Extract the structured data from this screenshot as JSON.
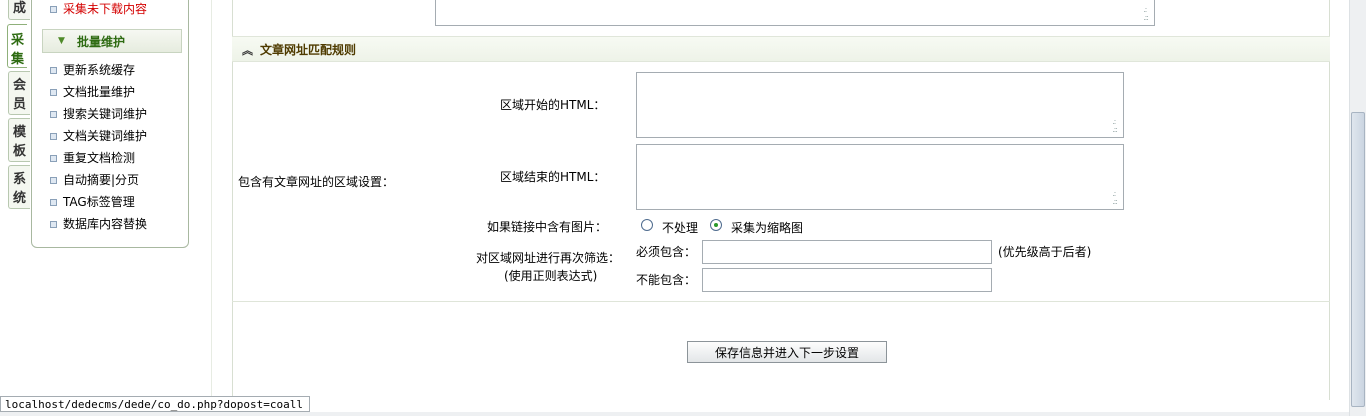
{
  "side_tabs": [
    {
      "label": "成",
      "active": false
    },
    {
      "label": "采集",
      "active": true
    },
    {
      "label": "会员",
      "active": false
    },
    {
      "label": "模板",
      "active": false
    },
    {
      "label": "系统",
      "active": false
    }
  ],
  "menu": {
    "top_item": "采集未下载内容",
    "group_label": "批量维护",
    "items": [
      "更新系统缓存",
      "文档批量维护",
      "搜索关键词维护",
      "文档关键词维护",
      "重复文档检测",
      "自动摘要|分页",
      "TAG标签管理",
      "数据库内容替换"
    ]
  },
  "section": {
    "title": "文章网址匹配规则"
  },
  "form": {
    "region_label": "包含有文章网址的区域设置：",
    "start_html_label": "区域开始的HTML：",
    "end_html_label": "区域结束的HTML：",
    "image_link_label": "如果链接中含有图片：",
    "image_options": [
      {
        "label": "不处理",
        "checked": false
      },
      {
        "label": "采集为缩略图",
        "checked": true
      }
    ],
    "filter_label_1": "对区域网址进行再次筛选：",
    "filter_label_2": "(使用正则表达式)",
    "must_contain_label": "必须包含：",
    "must_contain_note": "(优先级高于后者)",
    "cannot_contain_label": "不能包含：",
    "must_contain_value": "",
    "cannot_contain_value": "",
    "start_html_value": "",
    "end_html_value": ""
  },
  "submit_label": "保存信息并进入下一步设置",
  "status_url": "localhost/dedecms/dede/co_do.php?dopost=coall",
  "colors": {
    "menu_red": "#d40000",
    "group_green": "#2e6b12",
    "section_title": "#4f3b00"
  },
  "icons": [
    "bullet-icon",
    "collapse-arrow-icon",
    "chevron-up-double-icon",
    "resize-grip-icon"
  ]
}
